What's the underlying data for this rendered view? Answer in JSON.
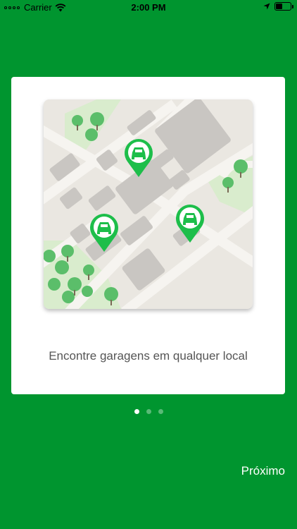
{
  "status_bar": {
    "carrier": "Carrier",
    "time": "2:00 PM",
    "battery_level": 0.45
  },
  "onboarding": {
    "caption": "Encontre garagens em qualquer local",
    "pages_total": 3,
    "current_page": 1,
    "next_label": "Próximo"
  },
  "colors": {
    "background": "#00952F",
    "pin": "#1DBE4A",
    "map_block": "#C9C6C2",
    "road": "#F4F2EE",
    "park": "#D9ECCD",
    "tree": "#5BBE6A"
  },
  "icons": {
    "map_pin": "car-pin-icon"
  }
}
